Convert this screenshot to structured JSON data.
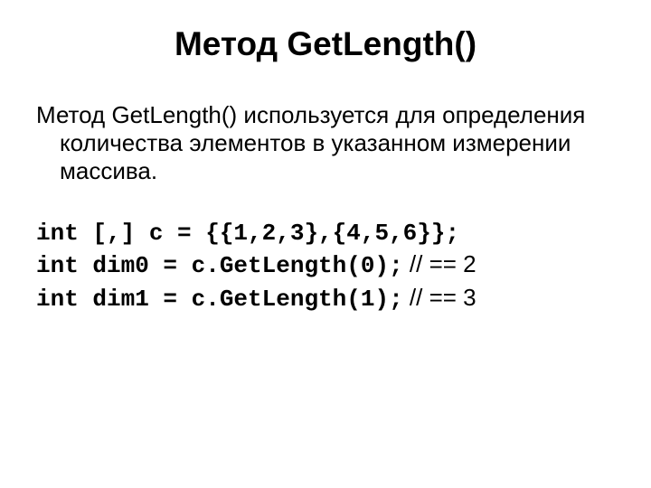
{
  "title": "Метод GetLength()",
  "description": "Метод GetLength() используется для определения количества элементов в указанном измерении массива.",
  "code": {
    "line1": "int [,] c = {{1,2,3},{4,5,6}};",
    "line2_code": "int dim0 = c.GetLength(0);",
    "line2_comment": " // == 2",
    "line3_code": "int dim1 = c.GetLength(1);",
    "line3_comment": " // == 3"
  }
}
